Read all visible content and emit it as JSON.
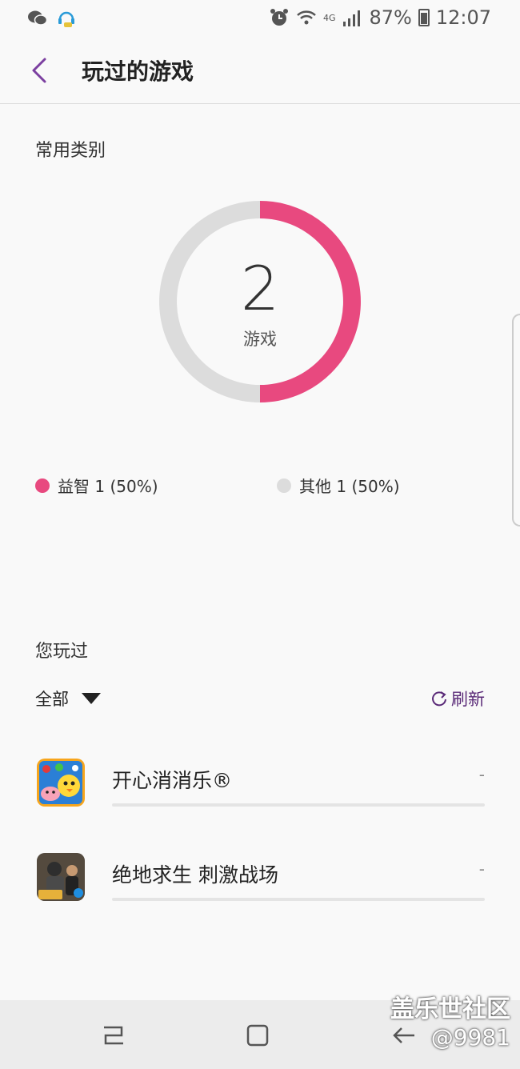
{
  "status_bar": {
    "battery": "87%",
    "time": "12:07",
    "network": "4G",
    "icons": [
      "wechat-icon",
      "headset-notification-icon",
      "alarm-icon",
      "wifi-icon",
      "signal-icon",
      "battery-icon"
    ]
  },
  "header": {
    "title": "玩过的游戏",
    "back_icon": "chevron-left-icon"
  },
  "categories": {
    "label": "常用类别",
    "total": "2",
    "unit": "游戏",
    "legend": [
      {
        "label": "益智 1 (50%)",
        "color": "#e8497f",
        "share": 0.5
      },
      {
        "label": "其他 1 (50%)",
        "color": "#dcdcdc",
        "share": 0.5
      }
    ]
  },
  "played": {
    "label": "您玩过",
    "filter_label": "全部",
    "refresh_label": "刷新",
    "games": [
      {
        "name": "开心消消乐®",
        "value": "-",
        "icon": "happy-elimination-game-icon"
      },
      {
        "name": "绝地求生 刺激战场",
        "value": "-",
        "icon": "pubg-game-icon"
      }
    ]
  },
  "watermark": {
    "line1": "盖乐世社区",
    "line2": "@9981"
  },
  "colors": {
    "accent": "#e8497f",
    "accent_purple": "#7b3fa0",
    "track": "#dcdcdc"
  }
}
